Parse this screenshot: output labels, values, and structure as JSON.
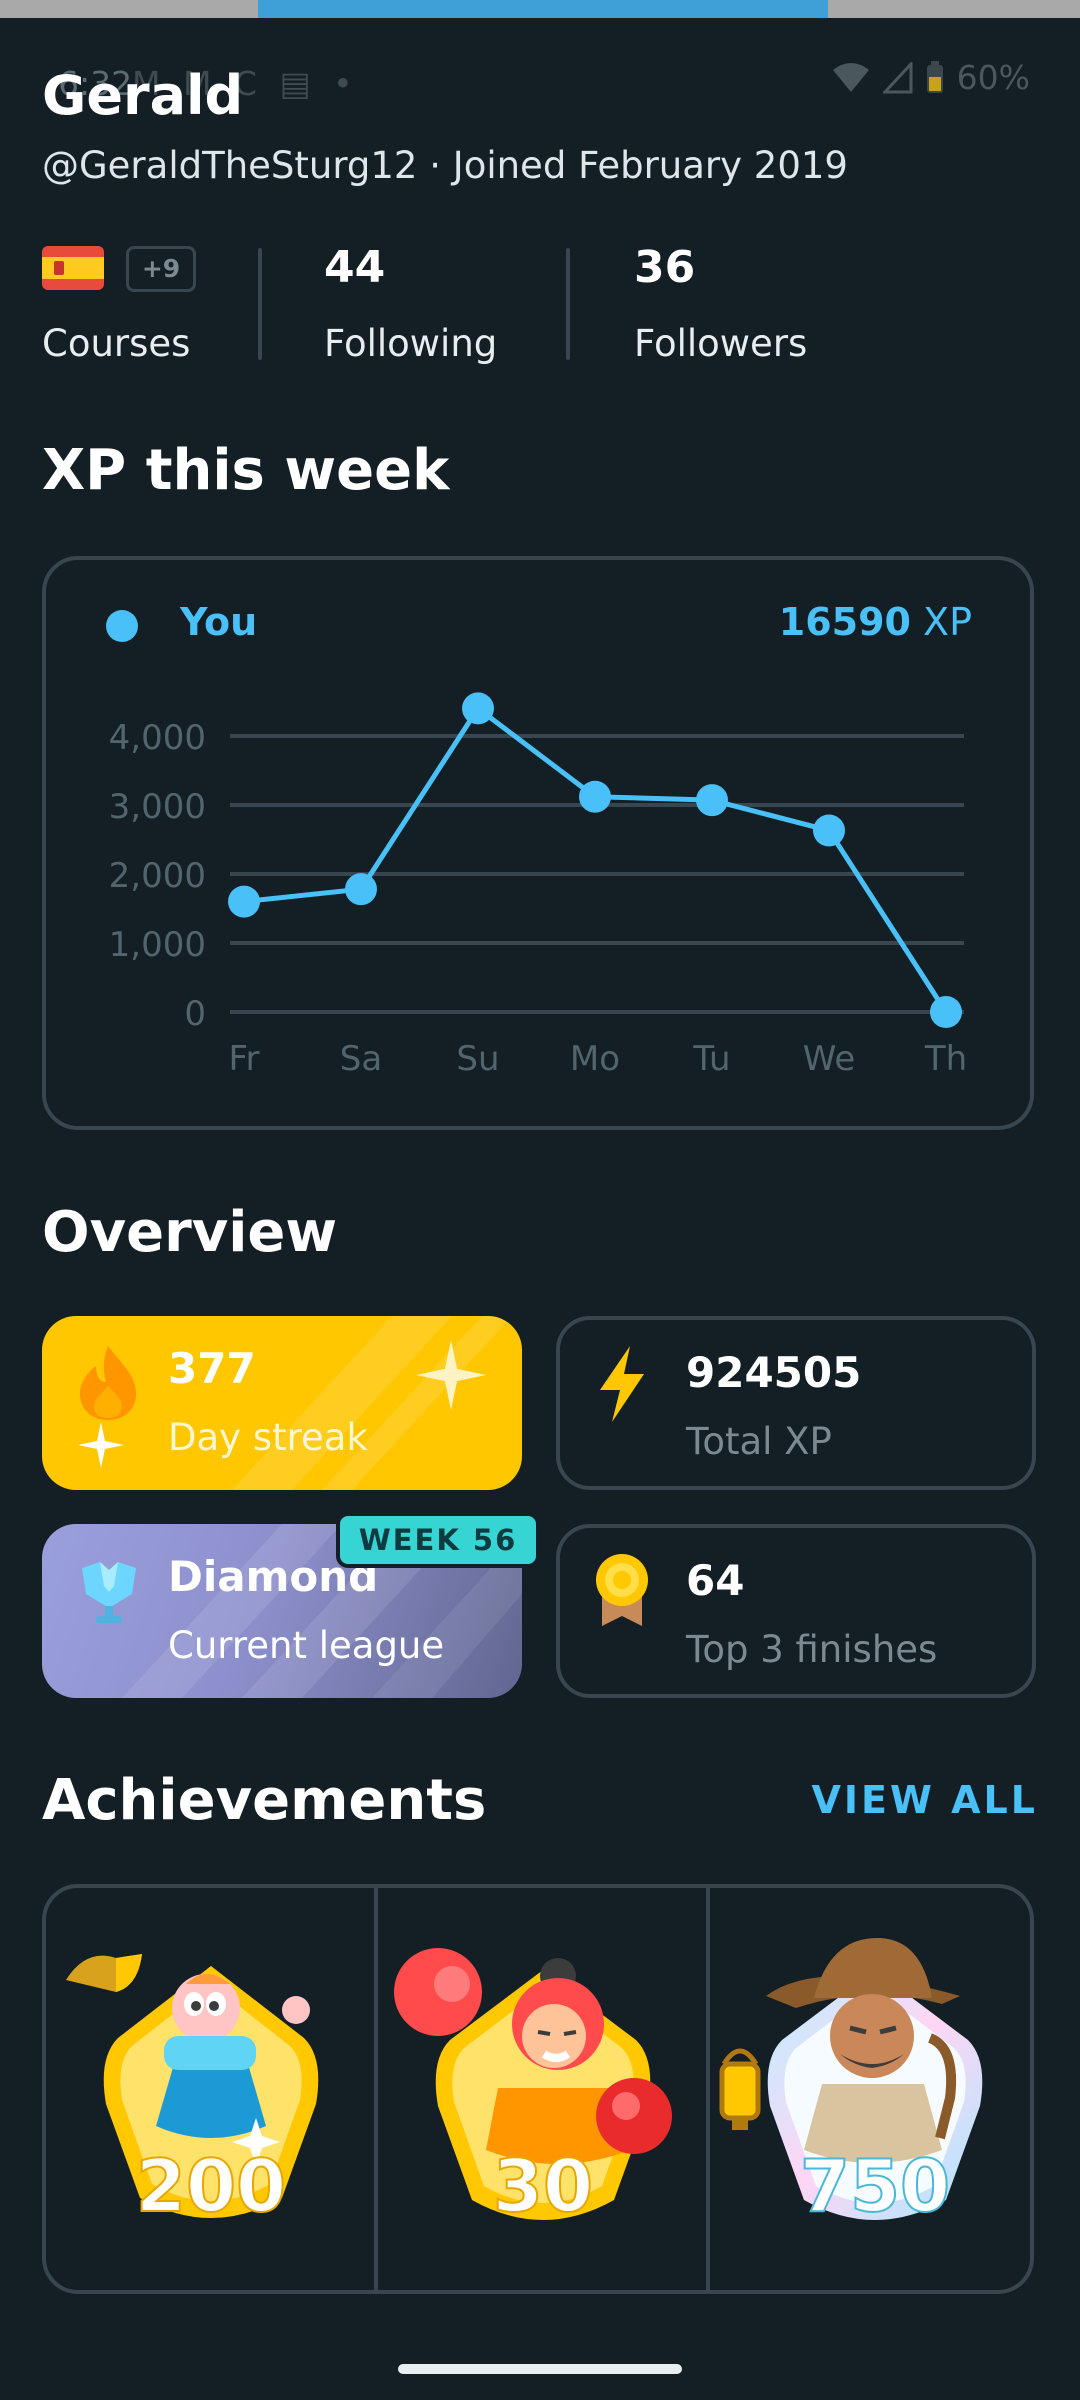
{
  "status_bar": {
    "time": "6:32",
    "notifications": "M M C ▤ •",
    "battery": "60%"
  },
  "profile": {
    "name": "Gerald",
    "username": "@GeraldTheSturg12",
    "joined": "Joined February 2019",
    "separator": "·",
    "courses_extra": "+9",
    "courses_label": "Courses",
    "following_count": "44",
    "following_label": "Following",
    "followers_count": "36",
    "followers_label": "Followers"
  },
  "xp_section": {
    "title": "XP this week",
    "legend": "You",
    "total_value": "16590",
    "total_unit": "XP"
  },
  "chart_data": {
    "type": "line",
    "categories": [
      "Fr",
      "Sa",
      "Su",
      "Mo",
      "Tu",
      "We",
      "Th"
    ],
    "series": [
      {
        "name": "You",
        "values": [
          1600,
          1780,
          4400,
          3120,
          3070,
          2630,
          0
        ],
        "color": "#49c0f8"
      }
    ],
    "yticks": [
      "4,000",
      "3,000",
      "2,000",
      "1,000",
      "0"
    ],
    "ytick_values": [
      4000,
      3000,
      2000,
      1000,
      0
    ],
    "ylim": [
      0,
      4500
    ],
    "grid": true
  },
  "overview": {
    "title": "Overview",
    "streak_value": "377",
    "streak_label": "Day streak",
    "total_xp_value": "924505",
    "total_xp_label": "Total XP",
    "league_value": "Diamond",
    "league_label": "Current league",
    "league_week": "WEEK 56",
    "top3_value": "64",
    "top3_label": "Top 3 finishes"
  },
  "achievements": {
    "title": "Achievements",
    "view_all": "VIEW ALL",
    "badges": [
      {
        "number": "200",
        "icon": "trophy-character-badge-icon"
      },
      {
        "number": "30",
        "icon": "boxer-character-badge-icon"
      },
      {
        "number": "750",
        "icon": "explorer-character-badge-icon"
      }
    ]
  },
  "colors": {
    "background": "#131f24",
    "accent": "#49c0f8",
    "border": "#37464f",
    "streak": "#ffc700",
    "week_badge": "#36d4d3"
  }
}
